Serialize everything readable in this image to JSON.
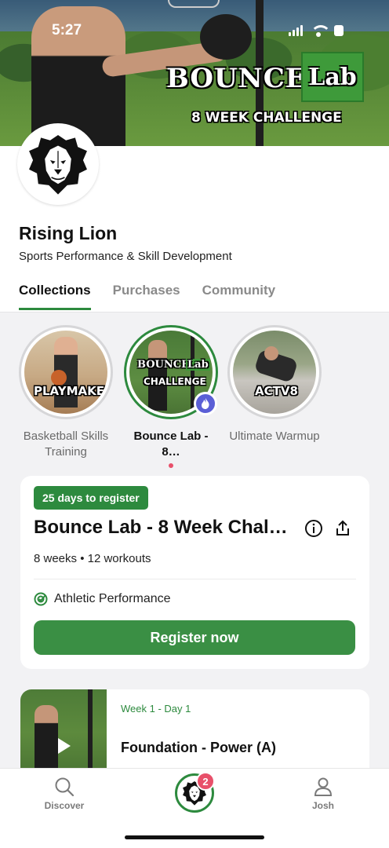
{
  "status_bar": {
    "time": "5:27"
  },
  "hero": {
    "brand_text": "BOUNCE",
    "brand_lab": "Lab",
    "subtitle": "8 WEEK CHALLENGE"
  },
  "profile": {
    "name": "Rising Lion",
    "tagline": "Sports Performance & Skill Development"
  },
  "tabs": [
    {
      "label": "Collections",
      "active": true
    },
    {
      "label": "Purchases",
      "active": false
    },
    {
      "label": "Community",
      "active": false
    }
  ],
  "collections": [
    {
      "thumb_text": "PLAYMAKER",
      "caption": "Basketball Skills Training",
      "active": false
    },
    {
      "thumb_text_1": "BOUNCE",
      "thumb_text_2": "Lab",
      "thumb_text_3": "CHALLENGE",
      "caption": "Bounce Lab - 8…",
      "active": true
    },
    {
      "thumb_text": "ACTV8",
      "caption": "Ultimate Warmup",
      "active": false
    }
  ],
  "program_card": {
    "register_pill": "25 days to register",
    "title": "Bounce Lab - 8 Week Chal…",
    "meta": "8 weeks • 12 workouts",
    "category": "Athletic Performance",
    "register_button": "Register now"
  },
  "workout_card": {
    "week_day": "Week 1 - Day 1",
    "title": "Foundation - Power (A)"
  },
  "bottom_nav": {
    "discover_label": "Discover",
    "center_badge_count": "2",
    "profile_label": "Josh"
  },
  "colors": {
    "accent_green": "#2d8a3e",
    "badge_red": "#e8506a",
    "fire_badge": "#5b5fd6"
  }
}
